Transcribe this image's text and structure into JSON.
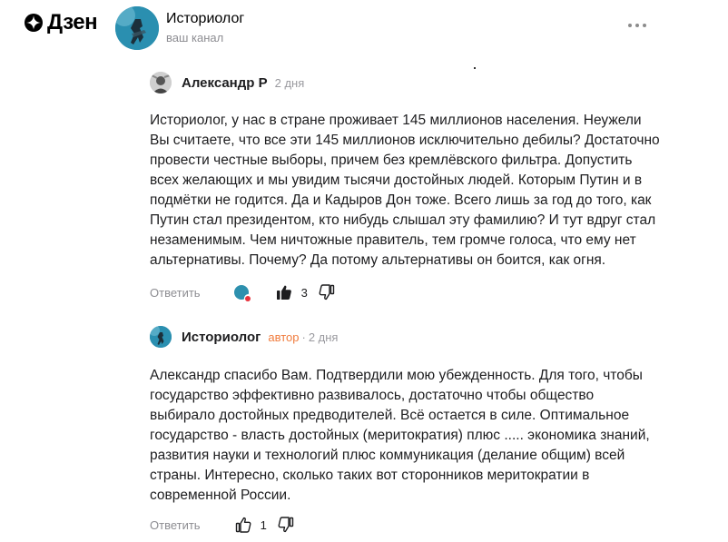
{
  "header": {
    "logo_text": "Дзен",
    "channel_name": "Историолог",
    "channel_subtitle": "ваш канал"
  },
  "comments": [
    {
      "author": "Александр Р",
      "date": "2 дня",
      "text": "Историолог, у нас в стране проживает 145 миллионов населения. Неужели Вы считаете, что все эти 145 миллионов исключительно дебилы? Достаточно провести честные выборы, причем без кремлёвского фильтра. Допустить всех желающих и мы увидим тысячи достойных людей. Которым Путин и в подмётки не годится. Да и Кадыров Дон тоже. Всего лишь за год до того, как Путин стал президентом, кто нибудь слышал эту фамилию? И тут вдруг стал незаменимым. Чем ничтожные правитель, тем громче голоса, что ему нет альтернативы. Почему? Да потому альтернативы он боится, как огня.",
      "reply_label": "Ответить",
      "likes": "3",
      "liked": true
    },
    {
      "author": "Историолог",
      "role": "автор",
      "separator": "·",
      "date": "2 дня",
      "text": "Александр спасибо Вам. Подтвердили мою убежденность. Для того, чтобы государство эффективно развивалось, достаточно чтобы общество выбирало достойных предводителей. Всё остается в силе. Оптимальное государство - власть достойных (меритократия) плюс ..... экономика знаний, развития науки и технологий плюс коммуникация (делание общим) всей страны. Интересно, сколько таких вот сторонников меритократии в современной России.",
      "reply_label": "Ответить",
      "likes": "1",
      "liked": false
    }
  ],
  "icons": {
    "logo": "dzen-star-icon",
    "more": "more-dots-icon",
    "like": "thumbs-up-icon",
    "dislike": "thumbs-down-icon",
    "reaction": "heart-icon"
  },
  "colors": {
    "author_badge": "#f07b3c",
    "muted": "#8d8d92",
    "like_reaction": "#e8323c",
    "avatar_accent": "#2d90ae"
  }
}
